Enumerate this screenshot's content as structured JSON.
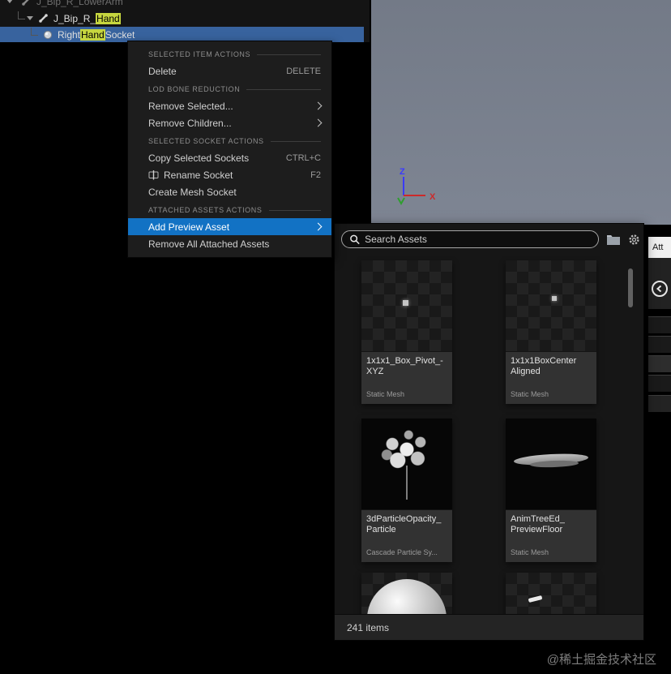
{
  "colors": {
    "selection_blue": "#38639e",
    "menu_highlight_blue": "#1272c4",
    "name_highlight_yellow": "#c6d63f",
    "viewport_gray": "#7b8290"
  },
  "skeleton_tree": {
    "rows": [
      {
        "pre": "J_Bip_R_LowerArm",
        "highlight": "",
        "post": ""
      },
      {
        "pre": "J_Bip_R_",
        "highlight": "Hand",
        "post": ""
      },
      {
        "pre": "Right",
        "highlight": "Hand",
        "post": "Socket"
      }
    ]
  },
  "context_menu": {
    "sections": [
      {
        "header": "SELECTED ITEM ACTIONS",
        "items": [
          {
            "label": "Delete",
            "shortcut": "DELETE"
          }
        ]
      },
      {
        "header": "LOD BONE REDUCTION",
        "items": [
          {
            "label": "Remove Selected..."
          },
          {
            "label": "Remove Children..."
          }
        ]
      },
      {
        "header": "SELECTED SOCKET ACTIONS",
        "items": [
          {
            "label": "Copy Selected Sockets",
            "shortcut": "CTRL+C"
          },
          {
            "label": "Rename Socket",
            "shortcut": "F2"
          },
          {
            "label": "Create Mesh Socket"
          }
        ]
      },
      {
        "header": "ATTACHED ASSETS ACTIONS",
        "items": [
          {
            "label": "Add Preview Asset"
          },
          {
            "label": "Remove All Attached Assets"
          }
        ]
      }
    ]
  },
  "asset_picker": {
    "search_placeholder": "Search Assets",
    "footer": "241 items",
    "assets": [
      {
        "line1": "1x1x1_Box_Pivot_-",
        "line2": "XYZ",
        "type": "Static Mesh"
      },
      {
        "line1": "1x1x1BoxCenter",
        "line2": "Aligned",
        "type": "Static Mesh"
      },
      {
        "line1": "3dParticleOpacity_",
        "line2": "Particle",
        "type": "Cascade Particle Sy..."
      },
      {
        "line1": "AnimTreeEd_",
        "line2": "PreviewFloor",
        "type": "Static Mesh"
      }
    ]
  },
  "viewport": {
    "axis_z": "Z",
    "axis_x": "X"
  },
  "right_panel": {
    "tab": "Att"
  },
  "watermark": "@稀土掘金技术社区"
}
